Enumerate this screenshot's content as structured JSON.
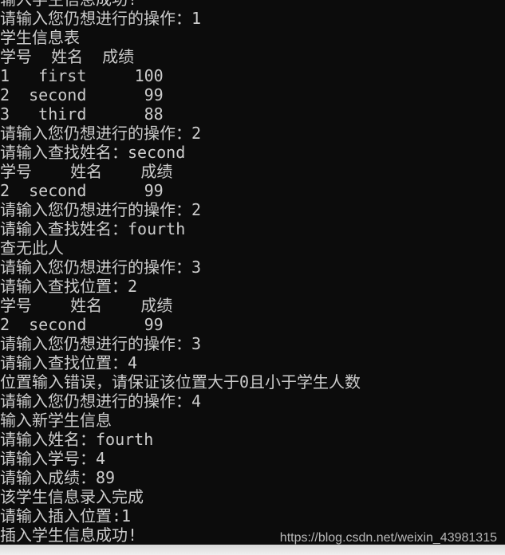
{
  "console": {
    "lines": [
      "输入学生信息成功!",
      "请输入您仍想进行的操作：1",
      "学生信息表",
      "学号  姓名  成绩",
      "1   first     100",
      "2  second      99",
      "3   third      88",
      "请输入您仍想进行的操作：2",
      "请输入查找姓名：second",
      "学号    姓名    成绩",
      "2  second      99",
      "请输入您仍想进行的操作：2",
      "请输入查找姓名：fourth",
      "查无此人",
      "请输入您仍想进行的操作：3",
      "请输入查找位置：2",
      "学号    姓名    成绩",
      "2  second      99",
      "请输入您仍想进行的操作：3",
      "请输入查找位置：4",
      "位置输入错误，请保证该位置大于0且小于学生人数",
      "请输入您仍想进行的操作：4",
      "输入新学生信息",
      "请输入姓名：fourth",
      "请输入学号：4",
      "请输入成绩：89",
      "该学生信息录入完成",
      "请输入插入位置:1",
      "插入学生信息成功!"
    ]
  },
  "watermark": "https://blog.csdn.net/weixin_43981315",
  "colors": {
    "background": "#0c0c0c",
    "text": "#cccccc"
  }
}
